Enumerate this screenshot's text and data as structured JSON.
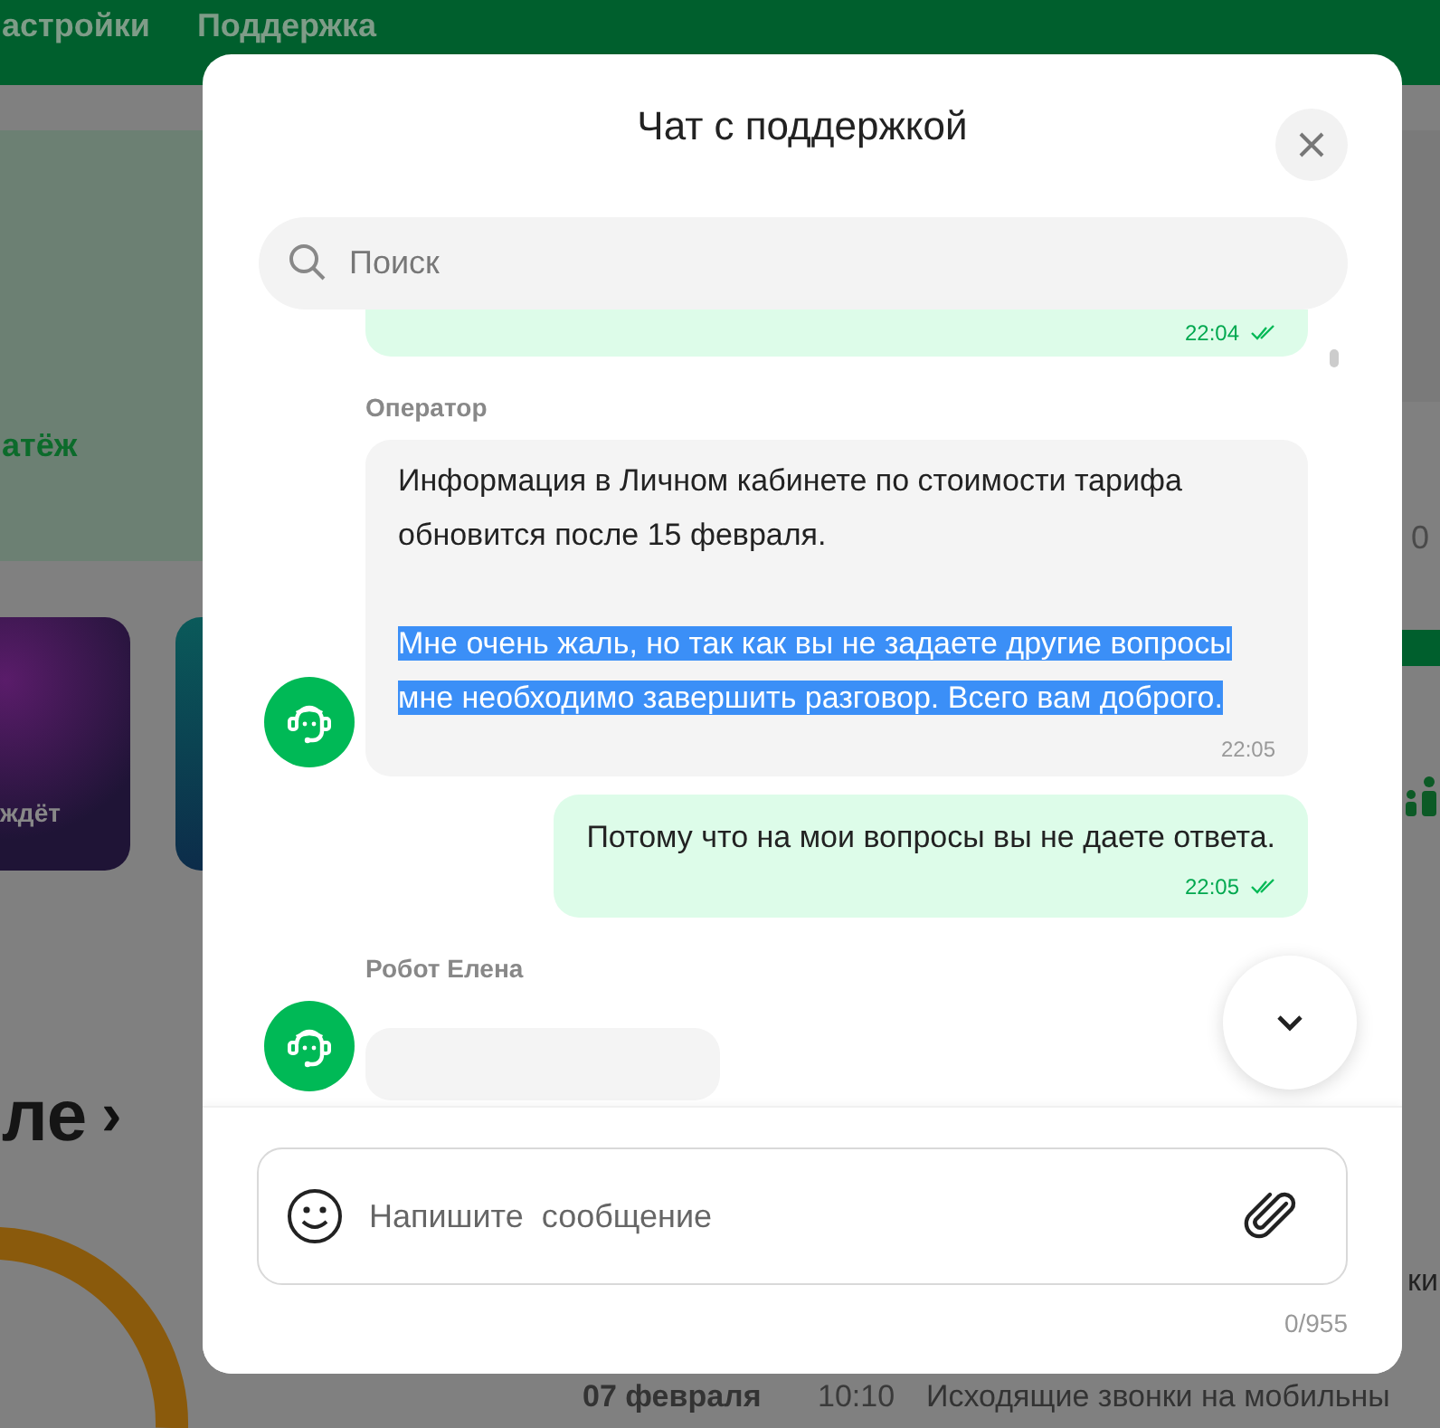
{
  "background": {
    "nav": [
      {
        "label": "астройки"
      },
      {
        "label": "Поддержка"
      }
    ],
    "payment_link": "атёж",
    "story_cards": [
      {
        "caption": "ждёт"
      }
    ],
    "section_heading": "ле",
    "section_arrow": "›",
    "right_value": "0",
    "right_text": "ки",
    "history_row": {
      "date": "07 февраля",
      "time": "10:10",
      "description": "Исходящие звонки на мобильны"
    }
  },
  "chat": {
    "title": "Чат с поддержкой",
    "search": {
      "placeholder": "Поиск"
    },
    "messages": [
      {
        "kind": "outgoing",
        "time": "22:04",
        "read": true
      },
      {
        "kind": "incoming",
        "sender": "Оператор",
        "paragraphs": [
          {
            "text": "Информация в Личном кабинете по стоимости тарифа обновится после 15 февраля.",
            "selected": false
          },
          {
            "text": "Мне очень жаль, но так как вы не задаете другие вопросы мне необходимо завершить разговор. Всего вам доброго.",
            "selected": true
          }
        ],
        "time": "22:05"
      },
      {
        "kind": "outgoing",
        "text": "Потому что на мои вопросы вы не даете ответа.",
        "time": "22:05",
        "read": true
      },
      {
        "kind": "incoming",
        "sender": "Робот Елена"
      }
    ],
    "composer": {
      "placeholder": "Напишите  сообщение",
      "counter": "0/955"
    }
  }
}
